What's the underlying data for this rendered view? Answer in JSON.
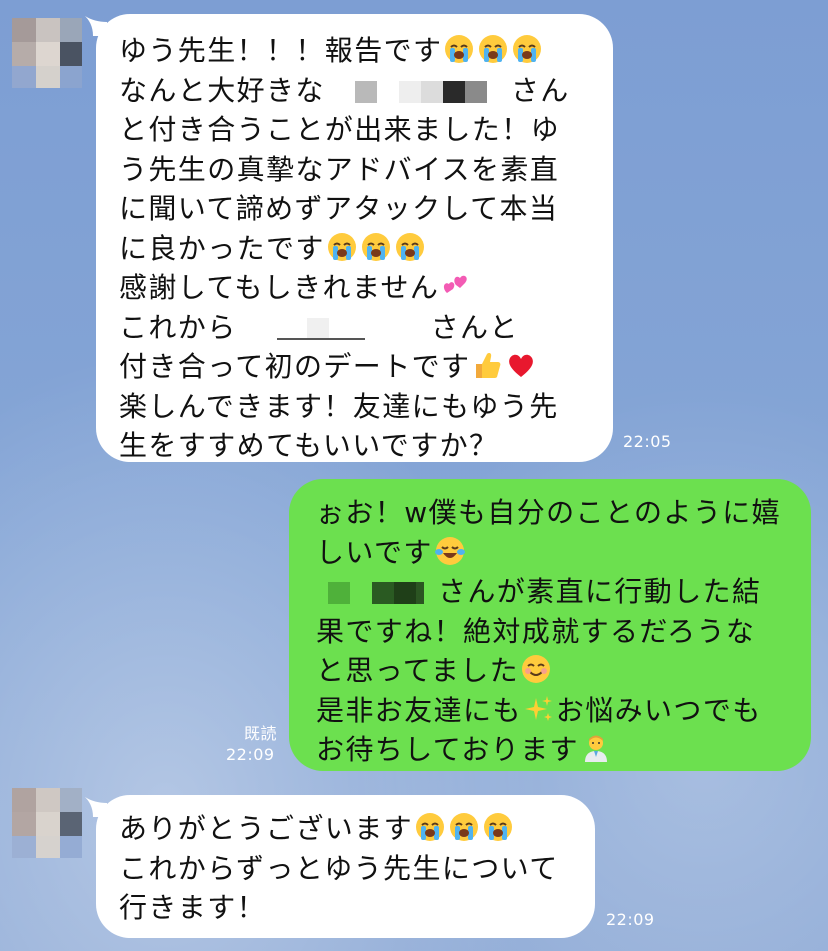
{
  "messages": [
    {
      "sender": "friend",
      "time": "22:05",
      "lines": [
        {
          "before": "ゆう先生！！！報告です",
          "emojis": [
            "loudly-crying-face",
            "loudly-crying-face",
            "loudly-crying-face"
          ]
        },
        {
          "before": "なんと大好きな",
          "after": "さん"
        },
        {
          "before": "と付き合うことが出来ました！ゆ"
        },
        {
          "before": "う先生の真摯なアドバイスを素直"
        },
        {
          "before": "に聞いて諦めずアタックして本当"
        },
        {
          "before": "に良かったです",
          "emojis": [
            "loudly-crying-face",
            "loudly-crying-face",
            "loudly-crying-face"
          ]
        },
        {
          "before": "感謝してもしきれません",
          "emojis": [
            "two-hearts"
          ]
        },
        {
          "before": "これから",
          "after": "さんと"
        },
        {
          "before": "付き合って初のデートです",
          "emojis": [
            "thumbs-up",
            "red-heart"
          ]
        },
        {
          "before": "楽しんできます！友達にもゆう先"
        },
        {
          "before": "生をすすめてもいいですか？"
        }
      ]
    },
    {
      "sender": "me",
      "read_label": "既読",
      "time": "22:09",
      "lines": [
        {
          "before": "ぉお！w僕も自分のことのように嬉"
        },
        {
          "before": "しいです",
          "emojis": [
            "face-with-tears-of-joy"
          ]
        },
        {
          "before": "",
          "after": "さんが素直に行動した結"
        },
        {
          "before": "果ですね！絶対成就するだろうな"
        },
        {
          "before": "と思ってました",
          "emojis": [
            "smiling-face"
          ]
        },
        {
          "before": "是非お友達にも",
          "emojis": [
            "sparkles"
          ],
          "after": "お悩みいつでも"
        },
        {
          "before": "お待ちしております",
          "emojis": [
            "man-health-worker"
          ]
        }
      ]
    },
    {
      "sender": "friend",
      "time": "22:09",
      "lines": [
        {
          "before": "ありがとうございます",
          "emojis": [
            "loudly-crying-face",
            "loudly-crying-face",
            "loudly-crying-face"
          ]
        },
        {
          "before": "これからずっとゆう先生について"
        },
        {
          "before": "行きます！"
        }
      ]
    }
  ]
}
